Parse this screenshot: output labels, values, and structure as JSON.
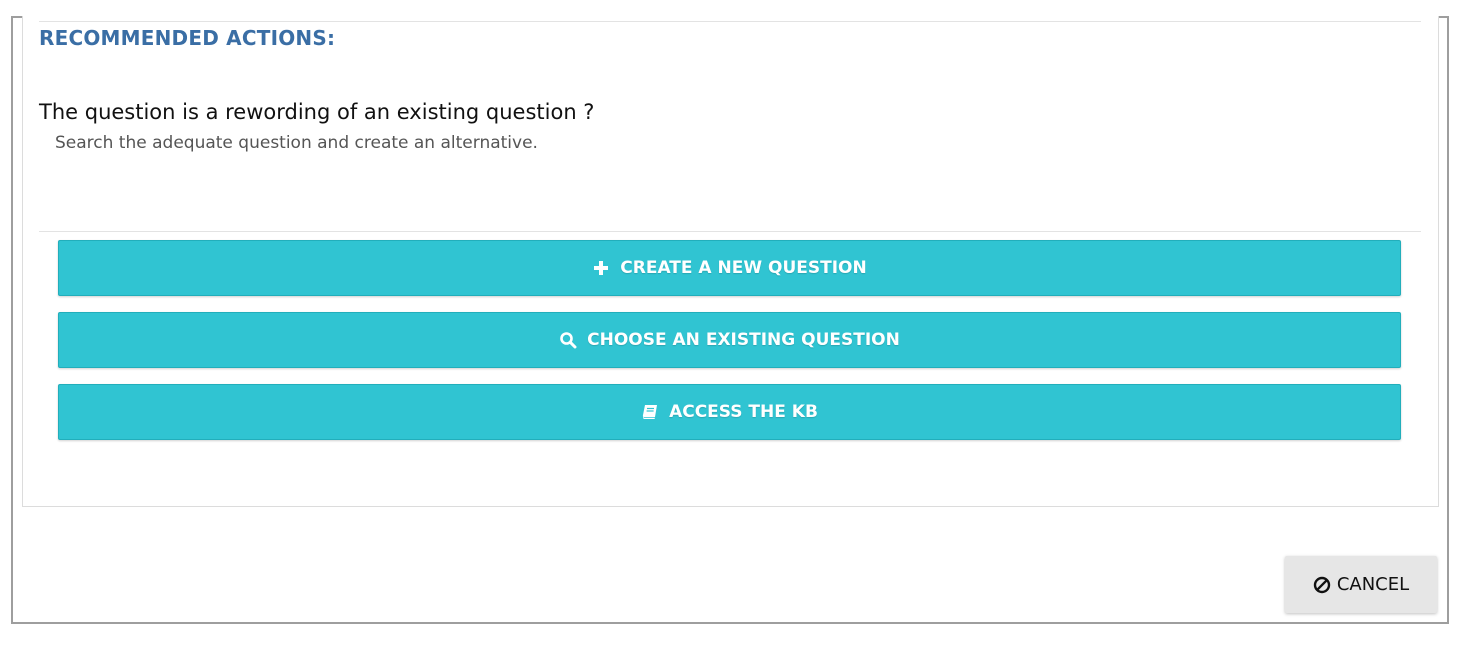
{
  "recommended": {
    "title": "RECOMMENDED ACTIONS:",
    "question": "The question is a rewording of an existing question ?",
    "hint": "Search the adequate question and create an alternative."
  },
  "actions": [
    {
      "label": "CREATE A NEW QUESTION",
      "icon": "plus-icon"
    },
    {
      "label": "CHOOSE AN EXISTING QUESTION",
      "icon": "search-icon"
    },
    {
      "label": "ACCESS THE KB",
      "icon": "book-icon"
    }
  ],
  "footer": {
    "cancel_label": "CANCEL",
    "cancel_icon": "ban-icon"
  },
  "colors": {
    "accent": "#30c4d2",
    "title": "#3a6ea5",
    "cancel_bg": "#e6e6e6"
  }
}
